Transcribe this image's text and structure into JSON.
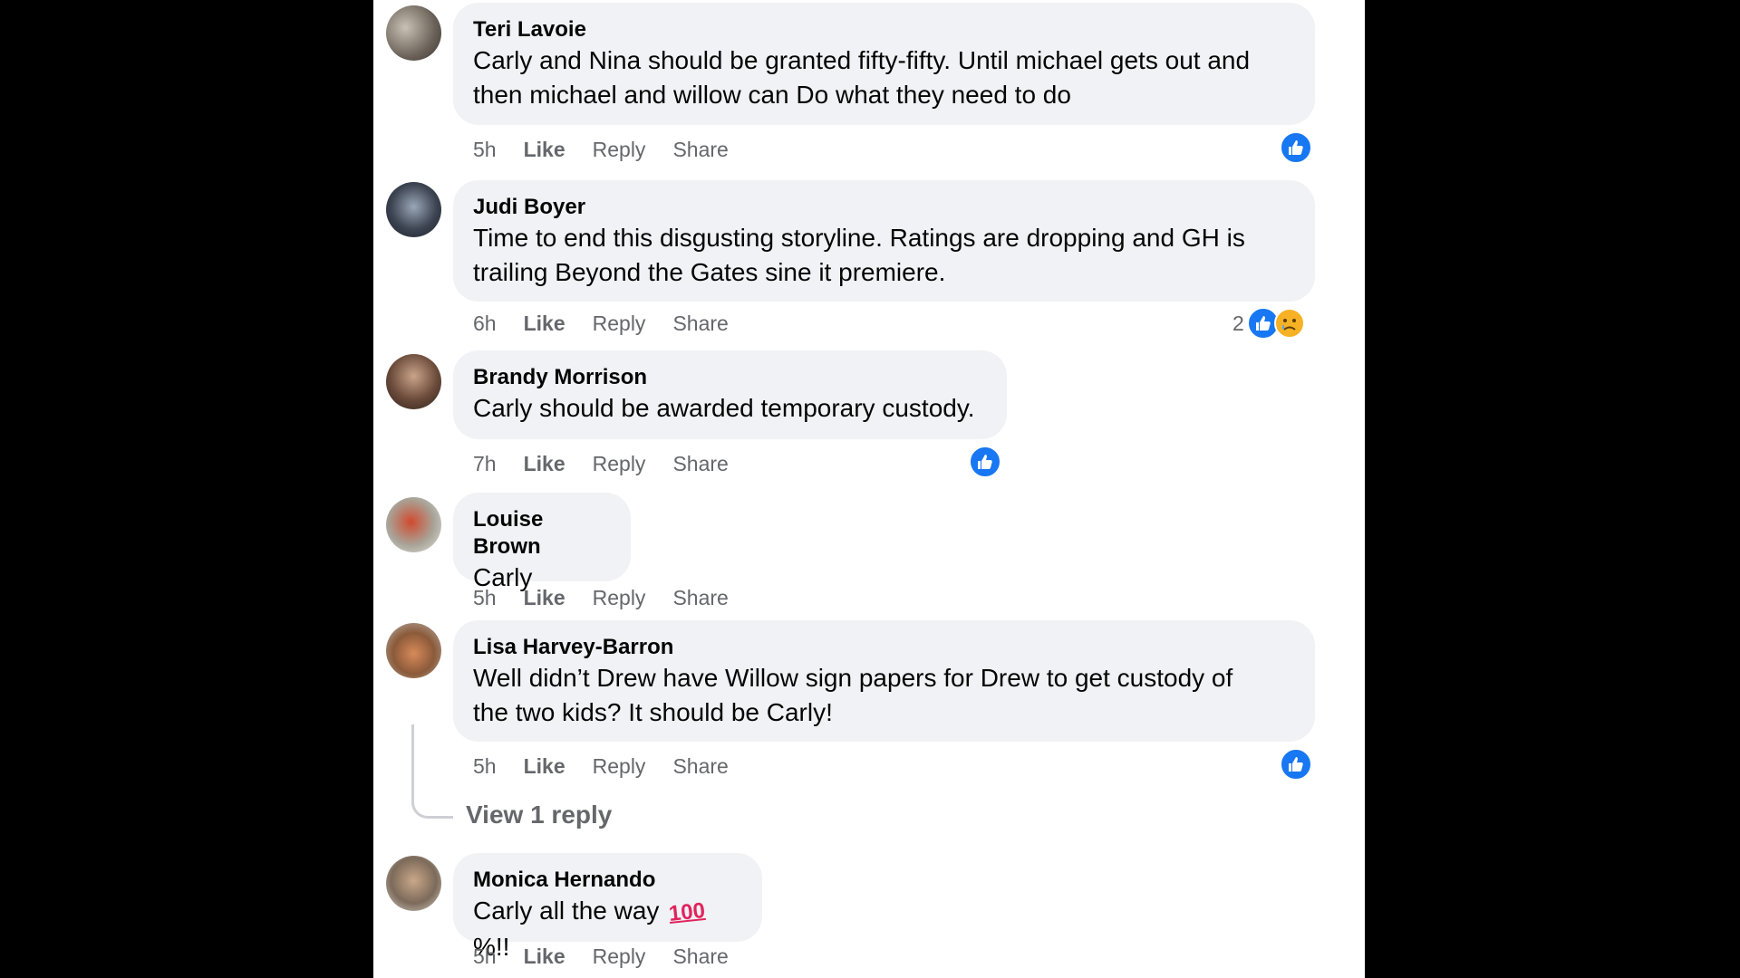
{
  "colors": {
    "like_blue": "#1877f2",
    "bubble_bg": "#f0f2f5",
    "meta_gray": "#65676b"
  },
  "actions": {
    "like": "Like",
    "reply": "Reply",
    "share": "Share"
  },
  "comments": [
    {
      "author": "Teri Lavoie",
      "lines": [
        "Carly and Nina should be granted fifty-fifty. Until michael gets out and",
        "then michael and willow can Do what they need to do"
      ],
      "time": "5h",
      "reaction_count": ""
    },
    {
      "author": "Judi Boyer",
      "lines": [
        "Time to end this disgusting storyline. Ratings are dropping and GH is",
        "trailing Beyond the Gates sine it premiere."
      ],
      "time": "6h",
      "reaction_count": "2"
    },
    {
      "author": "Brandy Morrison",
      "lines": [
        "Carly should be awarded temporary custody."
      ],
      "time": "7h",
      "reaction_count": ""
    },
    {
      "author": "Louise Brown",
      "lines": [
        "Carly"
      ],
      "time": "5h",
      "reaction_count": ""
    },
    {
      "author": "Lisa Harvey-Barron",
      "lines": [
        "Well didn’t Drew have Willow sign papers for Drew to get custody of",
        "the two kids? It should be Carly!"
      ],
      "time": "5h",
      "reaction_count": ""
    },
    {
      "author": "Monica Hernando",
      "lines": [
        "Carly all the way",
        "%!!"
      ],
      "time": "5h",
      "reaction_count": ""
    }
  ],
  "view_replies": "View 1 reply"
}
